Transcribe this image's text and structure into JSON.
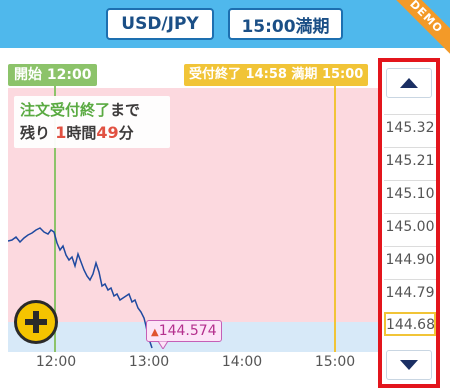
{
  "header": {
    "currency_pair": "USD/JPY",
    "expiry": "15:00満期",
    "demo_badge": "DEMO",
    "bg_color": "#4fb8ec"
  },
  "chart": {
    "start_label": "開始 12:00",
    "end_label": "受付終了 14:58 満期 15:00",
    "notice": {
      "line1_green": "注文受付終了",
      "line1_rest": "まで",
      "line2_prefix": "残り",
      "hours": "1",
      "hours_unit": "時間",
      "minutes": "49",
      "minutes_unit": "分"
    },
    "current_price": "144.574",
    "x_ticks": [
      "12:00",
      "13:00",
      "14:00",
      "15:00"
    ],
    "y_ticks": [
      "145.32",
      "145.21",
      "145.10",
      "145.00",
      "144.90",
      "144.79",
      "144.68"
    ],
    "icons": {
      "scroll_up": "triangle-up-icon",
      "scroll_down": "triangle-down-icon",
      "add": "plus-circle-icon"
    }
  }
}
